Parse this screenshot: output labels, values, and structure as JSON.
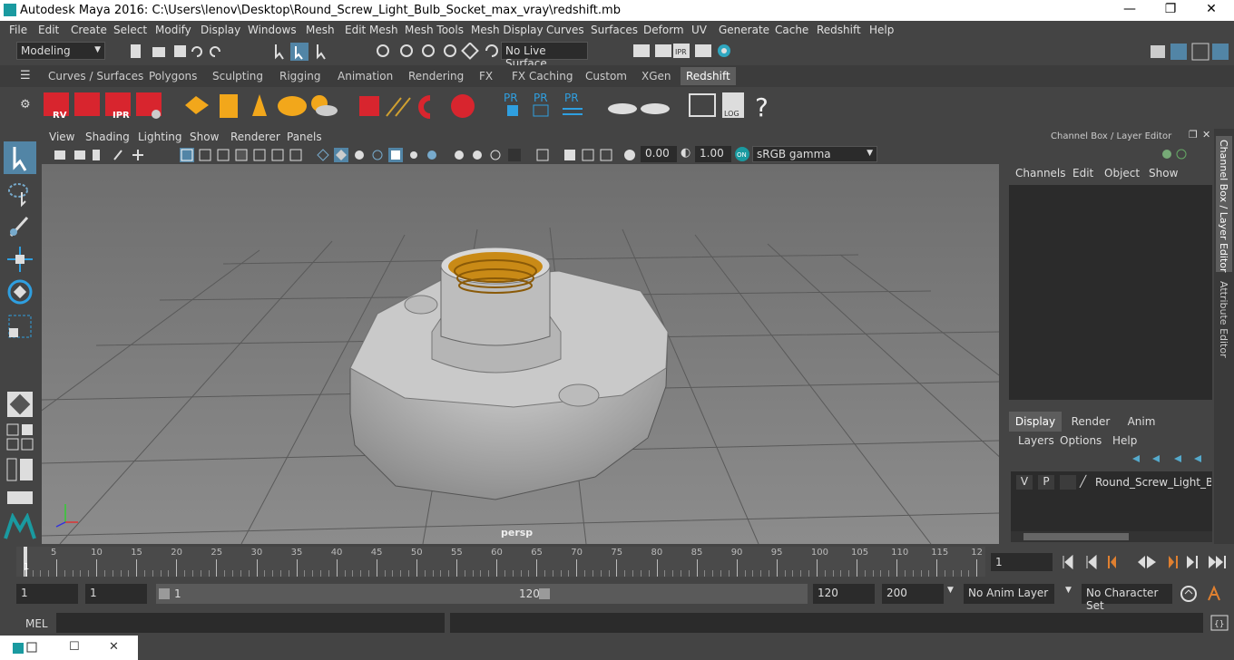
{
  "window": {
    "title": "Autodesk Maya 2016: C:\\Users\\lenov\\Desktop\\Round_Screw_Light_Bulb_Socket_max_vray\\redshift.mb",
    "minimize": "—",
    "maximize": "❐",
    "close": "✕"
  },
  "menu": [
    "File",
    "Edit",
    "Create",
    "Select",
    "Modify",
    "Display",
    "Windows",
    "Mesh",
    "Edit Mesh",
    "Mesh Tools",
    "Mesh Display",
    "Curves",
    "Surfaces",
    "Deform",
    "UV",
    "Generate",
    "Cache",
    "Redshift",
    "Help"
  ],
  "status": {
    "mode": "Modeling",
    "live_surface": "No Live Surface"
  },
  "shelf_tabs": [
    "Curves / Surfaces",
    "Polygons",
    "Sculpting",
    "Rigging",
    "Animation",
    "Rendering",
    "FX",
    "FX Caching",
    "Custom",
    "XGen",
    "Redshift"
  ],
  "shelf_active": "Redshift",
  "shelf_labels": {
    "rv": "RV",
    "ipr": "IPR",
    "pr1": "PR",
    "pr2": "PR",
    "pr3": "PR",
    "log": "LOG",
    "help": "?"
  },
  "viewport": {
    "menu": [
      "View",
      "Shading",
      "Lighting",
      "Show",
      "Renderer",
      "Panels"
    ],
    "exposure": "0.00",
    "gamma": "1.00",
    "colorspace": "sRGB gamma",
    "camera": "persp"
  },
  "channel_box": {
    "title": "Channel Box / Layer Editor",
    "menu": [
      "Channels",
      "Edit",
      "Object",
      "Show"
    ]
  },
  "layer_editor": {
    "tabs": [
      "Display",
      "Render",
      "Anim"
    ],
    "menu": [
      "Layers",
      "Options",
      "Help"
    ],
    "layer": {
      "v": "V",
      "p": "P",
      "name": "Round_Screw_Light_Bulb"
    }
  },
  "side_tabs": {
    "channel": "Channel Box / Layer Editor",
    "attr": "Attribute Editor"
  },
  "timeline": {
    "ticks": [
      "5",
      "10",
      "15",
      "20",
      "25",
      "30",
      "35",
      "40",
      "45",
      "50",
      "55",
      "60",
      "65",
      "70",
      "75",
      "80",
      "85",
      "90",
      "95",
      "100",
      "105",
      "110",
      "115",
      "12"
    ],
    "start_marker": "1",
    "current_frame": "1"
  },
  "range": {
    "start": "1",
    "anim_start": "1",
    "slider_start": "1",
    "slider_end": "120",
    "anim_end": "120",
    "end": "200",
    "anim_layer": "No Anim Layer",
    "char_set": "No Character Set"
  },
  "cmd": {
    "label": "MEL"
  },
  "colors": {
    "accent": "#5285a6",
    "background": "#444444",
    "viewport": "#7a7a7a",
    "redshift_red": "#d8252e"
  }
}
